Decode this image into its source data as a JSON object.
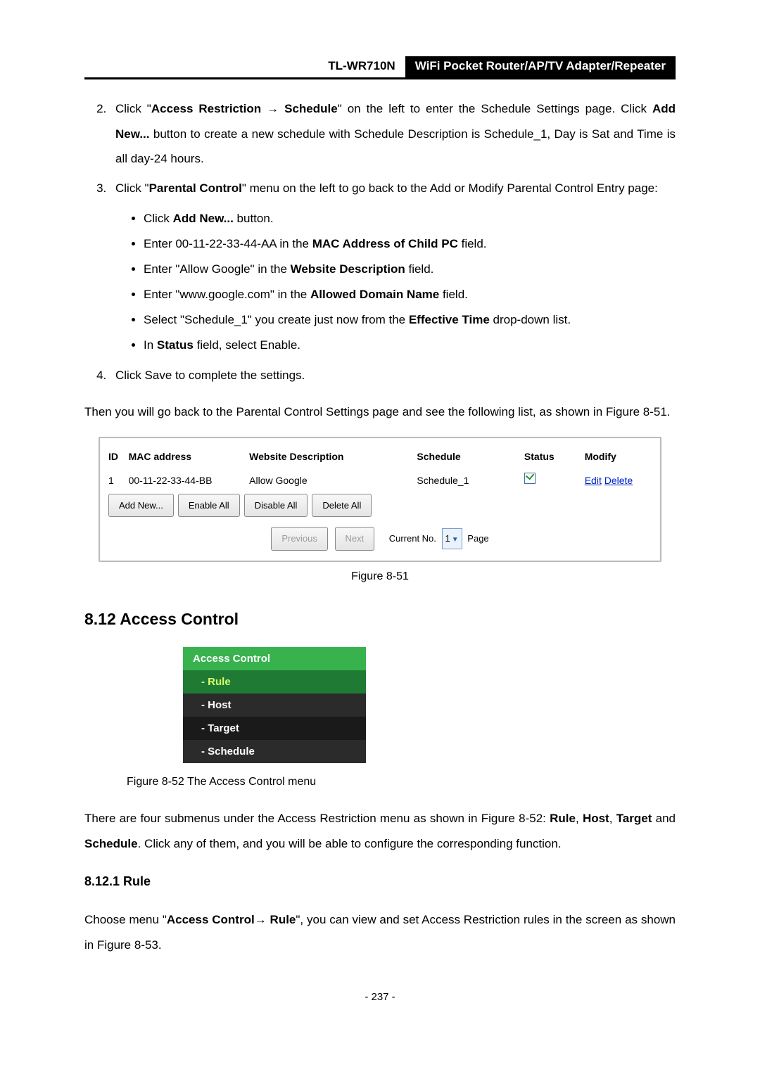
{
  "header": {
    "model": "TL-WR710N",
    "desc": "WiFi Pocket Router/AP/TV Adapter/Repeater"
  },
  "step2": {
    "pre": "Click \"",
    "bold1": "Access Restriction → Schedule",
    "mid1": "\" on the left to enter the Schedule Settings page. Click ",
    "bold2": "Add New...",
    "mid2": " button to create a new schedule with Schedule Description is Schedule_1, Day is Sat and Time is all day-24 hours."
  },
  "step3": {
    "pre": "Click \"",
    "bold1": "Parental Control",
    "post": "\" menu on the left to go back to the Add or Modify Parental Control Entry page:",
    "bullets": {
      "b1a": "Click ",
      "b1b": "Add New...",
      "b1c": " button.",
      "b2a": "Enter 00-11-22-33-44-AA in the ",
      "b2b": "MAC Address of Child PC",
      "b2c": " field.",
      "b3a": "Enter \"Allow Google\" in the ",
      "b3b": "Website Description",
      "b3c": " field.",
      "b4a": "Enter \"www.google.com\" in the ",
      "b4b": "Allowed Domain Name",
      "b4c": " field.",
      "b5a": "Select \"Schedule_1\" you create just now from the ",
      "b5b": "Effective Time",
      "b5c": " drop-down list.",
      "b6a": "In ",
      "b6b": "Status",
      "b6c": " field, select Enable."
    }
  },
  "step4": "Click Save to complete the settings.",
  "after_list": "Then you will go back to the Parental Control Settings page and see the following list, as shown in Figure 8-51.",
  "fig51": {
    "head": {
      "id": "ID",
      "mac": "MAC address",
      "wd": "Website Description",
      "sch": "Schedule",
      "st": "Status",
      "mod": "Modify"
    },
    "row": {
      "id": "1",
      "mac": "00-11-22-33-44-BB",
      "wd": "Allow Google",
      "sch": "Schedule_1",
      "edit": "Edit",
      "del": "Delete"
    },
    "btns": {
      "add": "Add New...",
      "en": "Enable All",
      "dis": "Disable All",
      "del": "Delete All"
    },
    "pager": {
      "prev": "Previous",
      "next": "Next",
      "cur": "Current No.",
      "sel": "1",
      "page": "Page"
    },
    "caption": "Figure 8-51"
  },
  "sec812": {
    "title": "8.12 Access Control",
    "menu": [
      "Access Control",
      "- Rule",
      "- Host",
      "- Target",
      "- Schedule"
    ],
    "caption": "Figure 8-52    The Access Control menu",
    "para_a": "There are four submenus under the Access Restriction menu as shown in Figure 8-52: ",
    "rule": "Rule",
    "comma1": ", ",
    "host": "Host",
    "comma2": ", ",
    "target": "Target",
    "and": " and ",
    "schedule": "Schedule",
    "para_b": ". Click any of them, and you will be able to configure the corresponding function."
  },
  "sec8121": {
    "title": "8.12.1 Rule",
    "p_a": "Choose menu \"",
    "b1": "Access Control",
    "arrow": "→ ",
    "b2": "Rule",
    "p_b": "\", you can view and set Access Restriction rules in the screen as shown in Figure 8-53."
  },
  "footer": "- 237 -"
}
